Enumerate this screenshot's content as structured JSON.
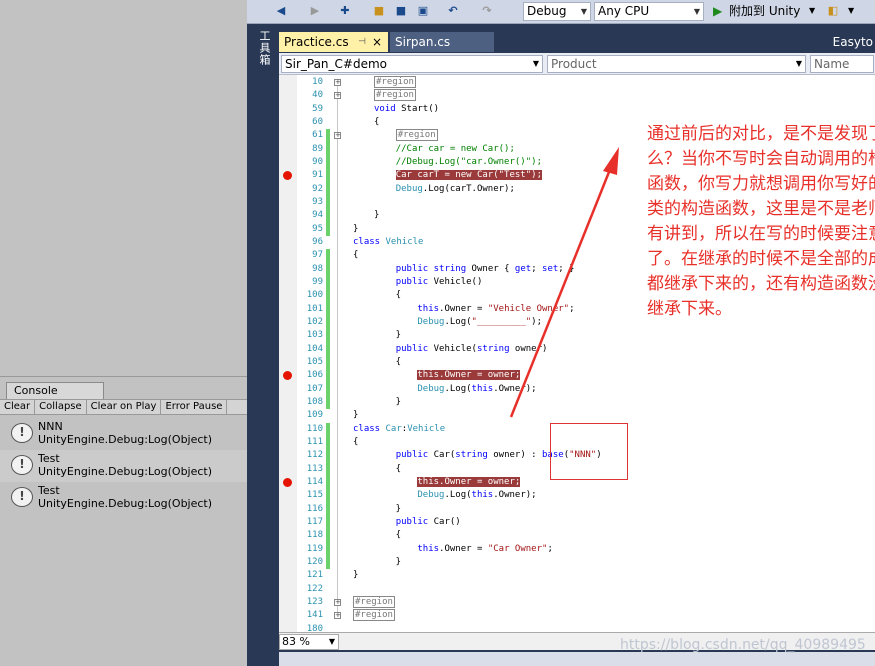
{
  "console": {
    "tab_label": "Console",
    "toolbar": [
      "Clear",
      "Collapse",
      "Clear on Play",
      "Error Pause"
    ],
    "logs": [
      {
        "title": "NNN",
        "detail": "UnityEngine.Debug:Log(Object)"
      },
      {
        "title": "Test",
        "detail": "UnityEngine.Debug:Log(Object)"
      },
      {
        "title": "Test",
        "detail": "UnityEngine.Debug:Log(Object)"
      }
    ]
  },
  "vs": {
    "toolbar": {
      "config": "Debug",
      "platform": "Any CPU",
      "attach": "附加到 Unity"
    },
    "toolbox_label": "工具箱",
    "tabs": [
      {
        "label": "Practice.cs",
        "close": "×"
      },
      {
        "label": "Sirpan.cs"
      }
    ],
    "tab_right": "Easyto",
    "nav": {
      "project": "Sir_Pan_C#demo",
      "type": "Product",
      "member": "Name"
    },
    "zoom": "83 %",
    "watermark": "https://blog.csdn.net/qq_40989495"
  },
  "annotation": "通过前后的对比，是不是发现了什么？当你不写时会自动调用的构造函数，你写力就想调用你写好的父类的构造函数，这里是不是老师没有讲到，所以在写的时候要注意了。在继承的时候不是全部的成员都继承下来的，还有构造函数没有继承下来。",
  "code_lines": [
    {
      "n": "10",
      "html": "<span class=\"reg\">#region</span>"
    },
    {
      "n": "40",
      "html": "<span class=\"reg\">#region</span>"
    },
    {
      "n": "59",
      "html": "<span class=\"kw\">void</span> Start()"
    },
    {
      "n": "60",
      "html": "{"
    },
    {
      "n": "61",
      "html": "    <span class=\"reg\">#region</span>"
    },
    {
      "n": "89",
      "html": "    <span class=\"cm\">//Car car = new Car();</span>"
    },
    {
      "n": "90",
      "html": "    <span class=\"cm\">//Debug.Log(\"car.Owner()\");</span>"
    },
    {
      "n": "91",
      "html": "    <span class=\"hl\">Car carT = new Car(\"Test\");</span>"
    },
    {
      "n": "92",
      "html": "    <span class=\"ty\">Debug</span>.Log(carT.Owner);"
    },
    {
      "n": "93",
      "html": ""
    },
    {
      "n": "94",
      "html": "}"
    },
    {
      "n": "95",
      "html": "}"
    },
    {
      "n": "96",
      "html": "<span class=\"kw\">class</span> <span class=\"ty\">Vehicle</span>"
    },
    {
      "n": "97",
      "html": "{"
    },
    {
      "n": "98",
      "html": "    <span class=\"kw\">public string</span> Owner { <span class=\"kw\">get</span>; <span class=\"kw\">set</span>; }"
    },
    {
      "n": "99",
      "html": "    <span class=\"kw\">public</span> Vehicle()"
    },
    {
      "n": "100",
      "html": "    {"
    },
    {
      "n": "101",
      "html": "        <span class=\"kw\">this</span>.Owner = <span class=\"st\">\"Vehicle Owner\"</span>;"
    },
    {
      "n": "102",
      "html": "        <span class=\"ty\">Debug</span>.Log(<span class=\"st\">\"_________\"</span>);"
    },
    {
      "n": "103",
      "html": "    }"
    },
    {
      "n": "104",
      "html": "    <span class=\"kw\">public</span> Vehicle(<span class=\"kw\">string</span> owner)"
    },
    {
      "n": "105",
      "html": "    {"
    },
    {
      "n": "106",
      "html": "        <span class=\"hl\">this.Owner = owner;</span>"
    },
    {
      "n": "107",
      "html": "        <span class=\"ty\">Debug</span>.Log(<span class=\"kw\">this</span>.Owner);"
    },
    {
      "n": "108",
      "html": "    }"
    },
    {
      "n": "109",
      "html": "}"
    },
    {
      "n": "110",
      "html": "<span class=\"kw\">class</span> <span class=\"ty\">Car</span>:<span class=\"ty\">Vehicle</span>"
    },
    {
      "n": "111",
      "html": "{"
    },
    {
      "n": "112",
      "html": "    <span class=\"kw\">public</span> Car(<span class=\"kw\">string</span> owner) : <span class=\"kw\">base</span>(<span class=\"st\">\"NNN\"</span>)"
    },
    {
      "n": "113",
      "html": "    {"
    },
    {
      "n": "114",
      "html": "        <span class=\"hl\">this.Owner = owner;</span>"
    },
    {
      "n": "115",
      "html": "        <span class=\"ty\">Debug</span>.Log(<span class=\"kw\">this</span>.Owner);"
    },
    {
      "n": "116",
      "html": "    }"
    },
    {
      "n": "117",
      "html": "    <span class=\"kw\">public</span> Car()"
    },
    {
      "n": "118",
      "html": "    {"
    },
    {
      "n": "119",
      "html": "        <span class=\"kw\">this</span>.Owner = <span class=\"st\">\"Car Owner\"</span>;"
    },
    {
      "n": "120",
      "html": "    }"
    },
    {
      "n": "121",
      "html": "}"
    },
    {
      "n": "122",
      "html": ""
    },
    {
      "n": "123",
      "html": "<span class=\"reg\">#region</span>"
    },
    {
      "n": "141",
      "html": "<span class=\"reg\">#region</span>"
    },
    {
      "n": "180",
      "html": ""
    }
  ],
  "breakpoints": [
    "91",
    "106",
    "114"
  ],
  "colors": {
    "breakpoint": "#e51400",
    "annotation": "#e8302a",
    "tab_active": "#fff1a8",
    "vs_frame": "#293955"
  }
}
